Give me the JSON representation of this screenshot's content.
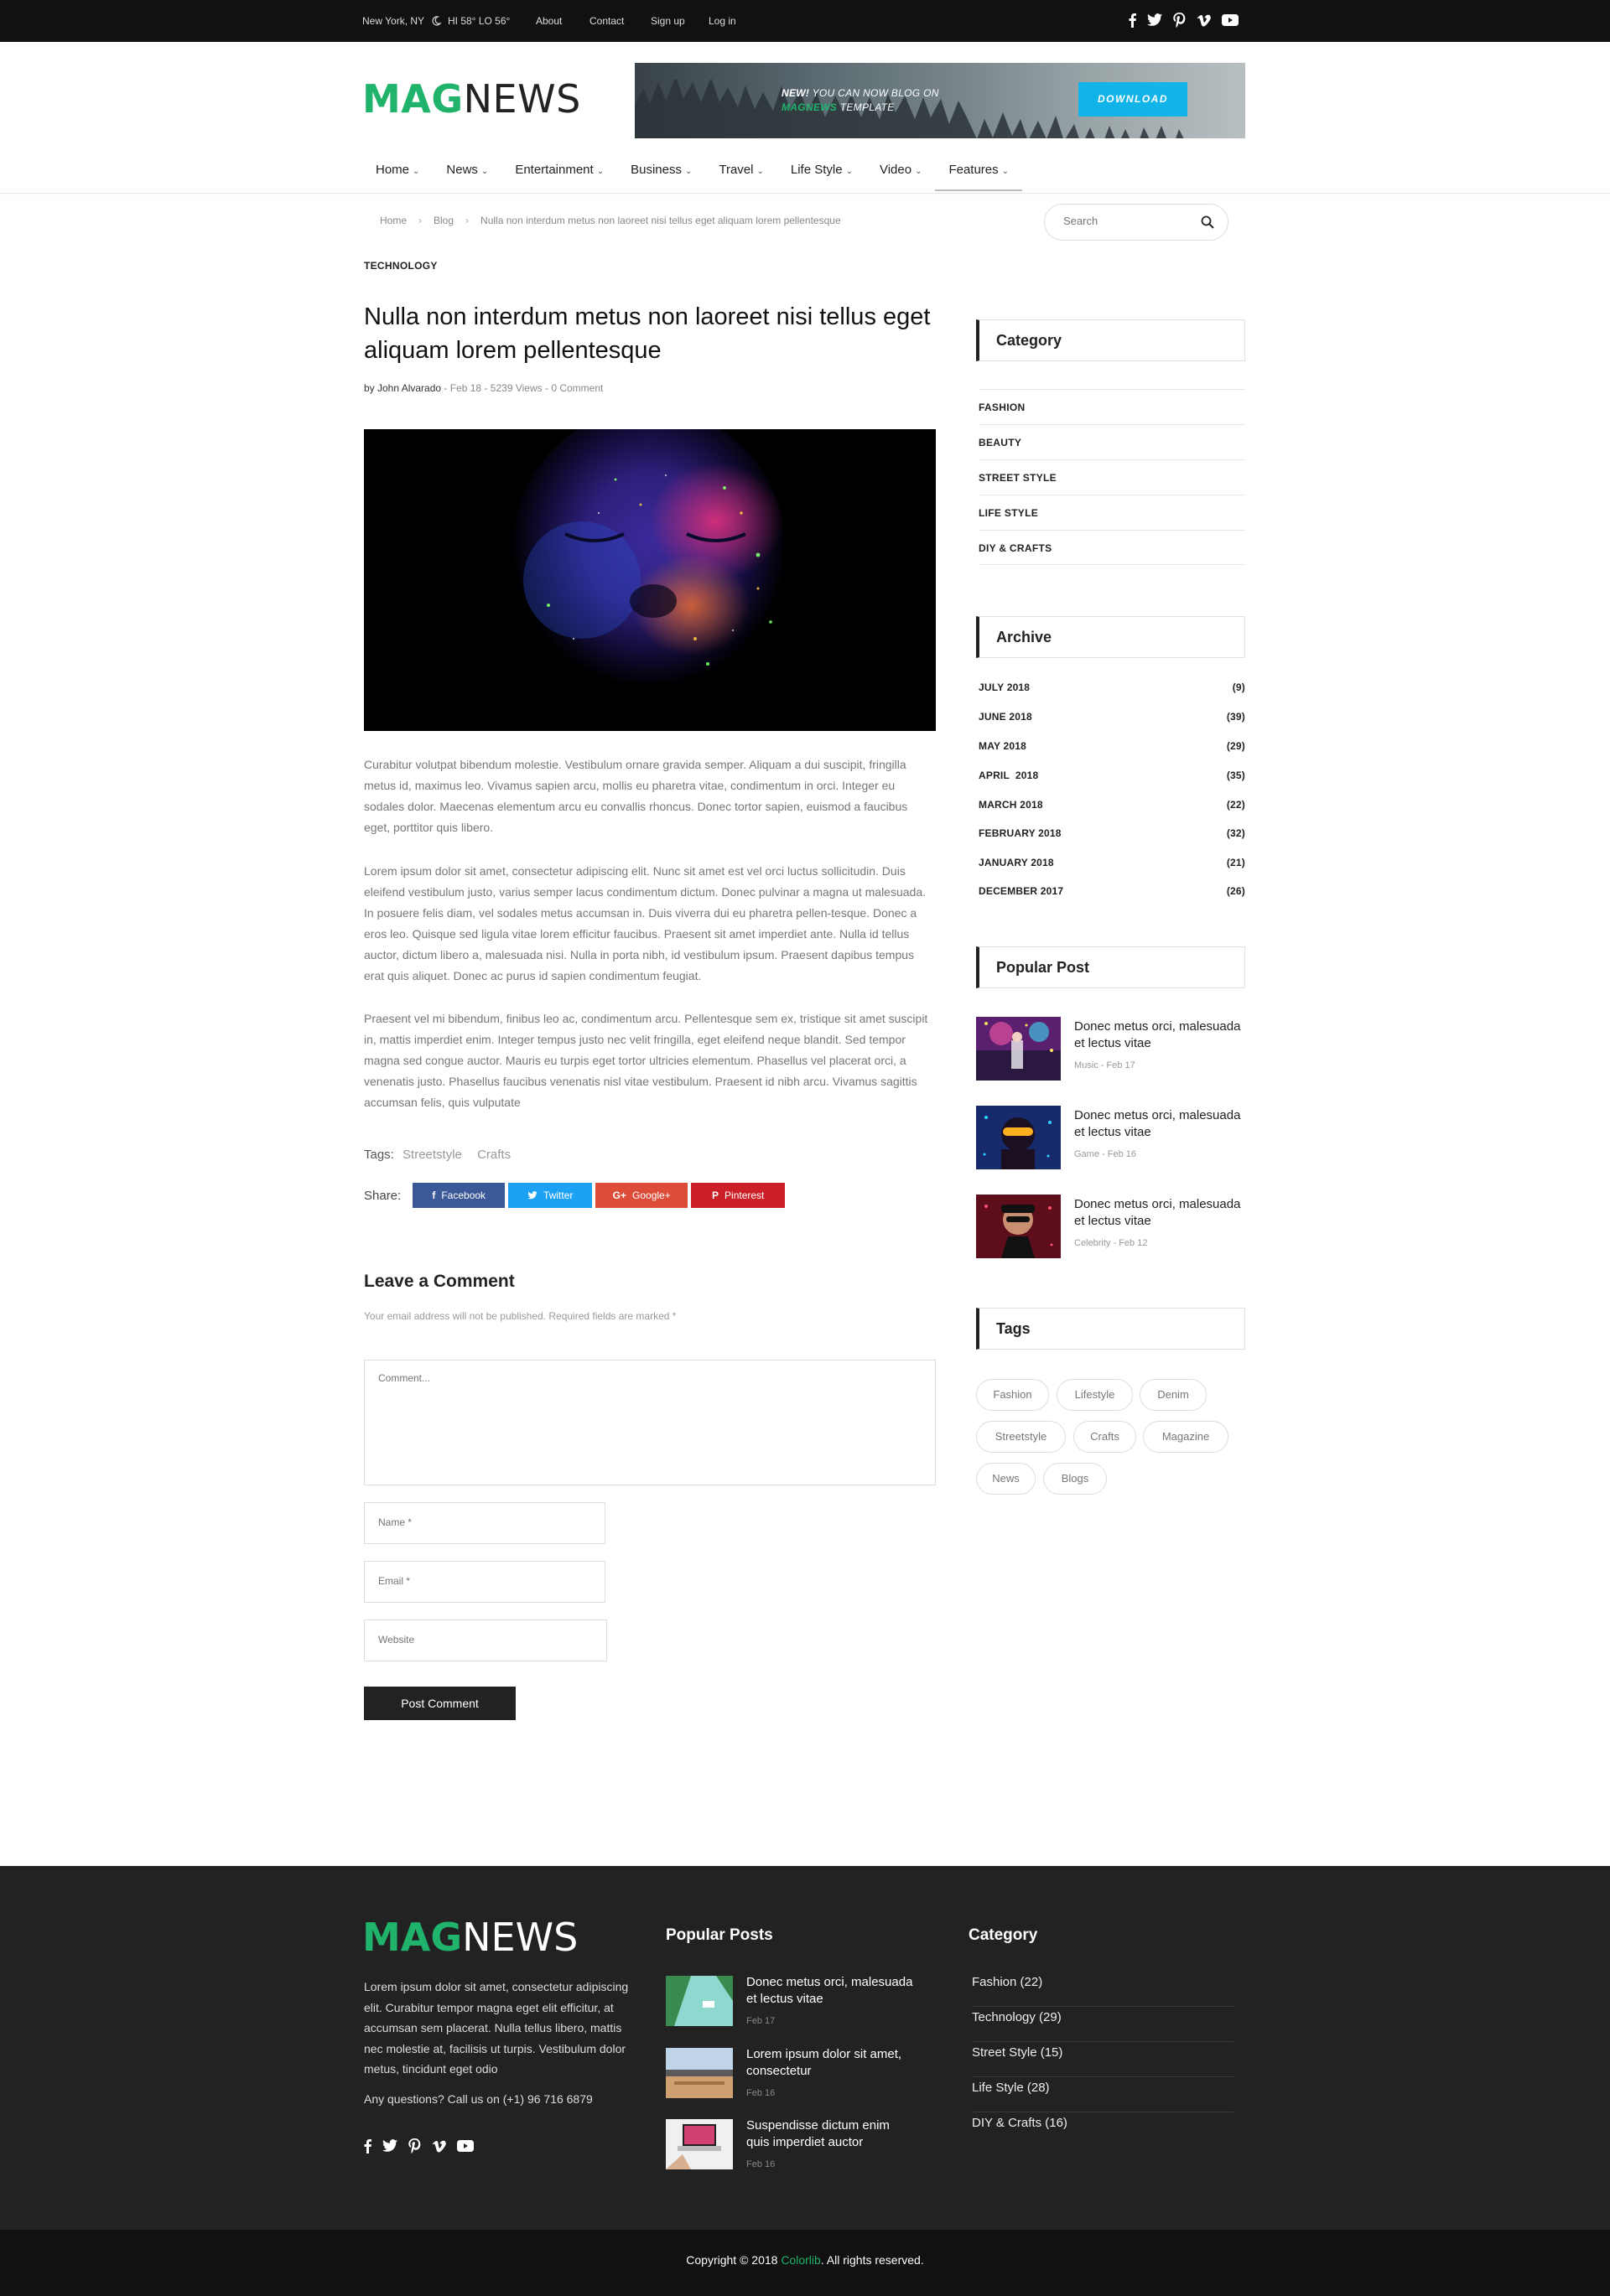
{
  "topbar": {
    "location": "New York, NY",
    "weather": "HI 58° LO 56°",
    "links": [
      "About",
      "Contact",
      "Sign up",
      "Log in"
    ],
    "social_icons": [
      "facebook-icon",
      "twitter-icon",
      "pinterest-icon",
      "vimeo-icon",
      "youtube-icon"
    ]
  },
  "brand": {
    "mag": "MAG",
    "news": "NEWS",
    "accent": "#1fb36b"
  },
  "banner": {
    "new": "NEW!",
    "line1": " YOU CAN NOW BLOG ON",
    "line2_brand": "MAGNEWS",
    "line2": " TEMPLATE",
    "button": "DOWNLOAD"
  },
  "nav": {
    "items": [
      "Home",
      "News",
      "Entertainment",
      "Business",
      "Travel",
      "Life Style",
      "Video",
      "Features"
    ],
    "active": "Features"
  },
  "breadcrumb": [
    "Home",
    "Blog",
    "Nulla non interdum metus non laoreet nisi tellus eget aliquam lorem pellentesque"
  ],
  "search": {
    "placeholder": "Search"
  },
  "article": {
    "category": "TECHNOLOGY",
    "title": "Nulla non interdum metus non laoreet nisi tellus eget aliquam lorem pellentesque",
    "author": "by John Alvarado",
    "date": "Feb 18",
    "views": "5239 Views",
    "comments": "0 Comment",
    "paragraphs": [
      "Curabitur volutpat bibendum molestie. Vestibulum ornare gravida semper. Aliquam a dui suscipit, fringilla metus id, maximus leo. Vivamus sapien arcu, mollis eu pharetra vitae, condimentum in orci. Integer eu sodales dolor. Maecenas elementum arcu eu convallis rhoncus. Donec tortor sapien, euismod a faucibus eget, porttitor quis libero.",
      "Lorem ipsum dolor sit amet, consectetur adipiscing elit. Nunc sit amet est vel orci luctus sollicitudin. Duis eleifend vestibulum justo, varius semper lacus condimentum dictum. Donec pulvinar a magna ut malesuada. In posuere felis diam, vel sodales metus accumsan in. Duis viverra dui eu pharetra pellen-tesque. Donec a eros leo. Quisque sed ligula vitae lorem efficitur faucibus. Praesent sit amet imperdiet ante. Nulla id tellus auctor, dictum libero a, malesuada nisi. Nulla in porta nibh, id vestibulum ipsum. Praesent dapibus tempus erat quis aliquet. Donec ac purus id sapien condimentum feugiat.",
      "Praesent vel mi bibendum, finibus leo ac, condimentum arcu. Pellentesque sem ex, tristique sit amet suscipit in, mattis imperdiet enim. Integer tempus justo nec velit fringilla, eget eleifend neque blandit. Sed tempor magna sed congue auctor. Mauris eu turpis eget tortor ultricies elementum. Phasellus vel placerat orci, a venenatis justo. Phasellus faucibus venenatis nisl vitae vestibulum. Praesent id nibh arcu. Vivamus sagittis accumsan felis, quis vulputate"
    ],
    "tags_label": "Tags:",
    "tags": [
      "Streetstyle",
      "Crafts"
    ],
    "share_label": "Share:",
    "share": [
      {
        "label": "Facebook",
        "color": "#3b5998",
        "icon": "facebook-icon"
      },
      {
        "label": "Twitter",
        "color": "#1da1f2",
        "icon": "twitter-icon"
      },
      {
        "label": "Google+",
        "color": "#dd4b39",
        "icon": "google-plus-icon"
      },
      {
        "label": "Pinterest",
        "color": "#cb2027",
        "icon": "pinterest-icon"
      }
    ]
  },
  "comment_form": {
    "heading": "Leave a Comment",
    "note": "Your email address will not be published. Required fields are marked *",
    "comment_placeholder": "Comment...",
    "name_placeholder": "Name *",
    "email_placeholder": "Email *",
    "website_placeholder": "Website",
    "submit": "Post Comment"
  },
  "sidebar": {
    "category_title": "Category",
    "categories": [
      "FASHION",
      "BEAUTY",
      "STREET STYLE",
      "LIFE STYLE",
      "DIY & CRAFTS"
    ],
    "archive_title": "Archive",
    "archive": [
      {
        "month": "JULY 2018",
        "count": "(9)"
      },
      {
        "month": "JUNE 2018",
        "count": "(39)"
      },
      {
        "month": "MAY 2018",
        "count": "(29)"
      },
      {
        "month": "APRIL  2018",
        "count": "(35)"
      },
      {
        "month": "MARCH 2018",
        "count": "(22)"
      },
      {
        "month": "FEBRUARY 2018",
        "count": "(32)"
      },
      {
        "month": "JANUARY 2018",
        "count": "(21)"
      },
      {
        "month": "DECEMBER 2017",
        "count": "(26)"
      }
    ],
    "popular_title": "Popular Post",
    "popular": [
      {
        "title": "Donec metus orci, malesuada et lectus vitae",
        "cat": "Music",
        "date": "Feb 17"
      },
      {
        "title": "Donec metus orci, malesuada et lectus vitae",
        "cat": "Game",
        "date": "Feb 16"
      },
      {
        "title": "Donec metus orci, malesuada et lectus vitae",
        "cat": "Celebrity",
        "date": "Feb 12"
      }
    ],
    "tags_title": "Tags",
    "tags": [
      "Fashion",
      "Lifestyle",
      "Denim",
      "Streetstyle",
      "Crafts",
      "Magazine",
      "News",
      "Blogs"
    ]
  },
  "footer": {
    "about": "Lorem ipsum dolor sit amet, consectetur adipiscing elit. Curabitur tempor magna eget elit efficitur, at accumsan sem placerat. Nulla tellus libero, mattis nec molestie at, facilisis ut turpis. Vestibulum dolor metus, tincidunt eget odio",
    "questions": "Any questions? Call us on (+1) 96 716 6879",
    "popular_title": "Popular Posts",
    "popular": [
      {
        "title": "Donec metus orci, malesuada et lectus vitae",
        "date": "Feb 17"
      },
      {
        "title": "Lorem ipsum dolor sit amet, consectetur",
        "date": "Feb 16"
      },
      {
        "title": "Suspendisse dictum enim quis imperdiet auctor",
        "date": "Feb 16"
      }
    ],
    "category_title": "Category",
    "categories": [
      "Fashion (22)",
      "Technology (29)",
      "Street Style (15)",
      "Life Style (28)",
      "DIY & Crafts (16)"
    ],
    "copyright_pre": "Copyright © 2018 ",
    "copyright_link": "Colorlib",
    "copyright_post": ". All rights reserved."
  }
}
